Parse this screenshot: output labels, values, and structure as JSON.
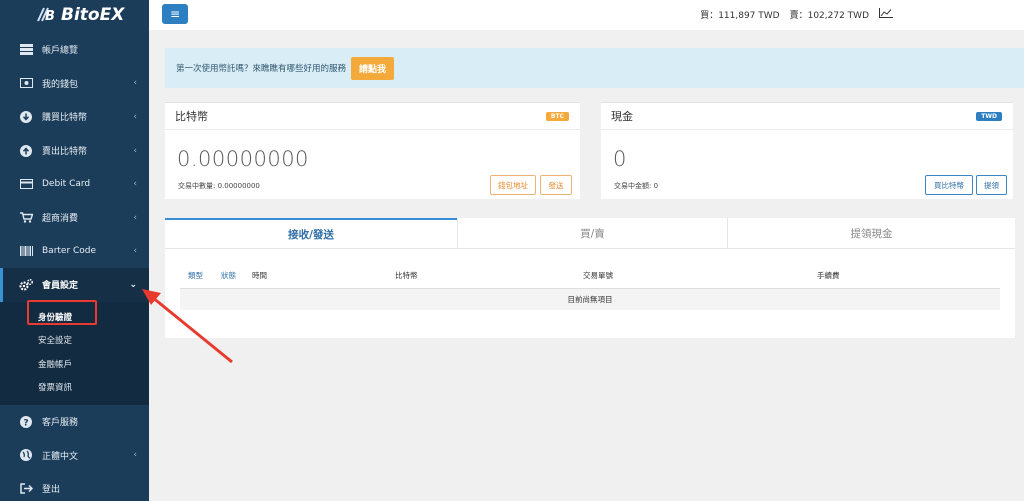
{
  "brand": {
    "name": "BitoEX"
  },
  "sidebar": {
    "items": [
      {
        "label": "帳戶總覽",
        "icon": "dashboard-icon",
        "chevron": false
      },
      {
        "label": "我的錢包",
        "icon": "wallet-icon",
        "chevron": true
      },
      {
        "label": "購買比特幣",
        "icon": "download-circle-icon",
        "chevron": true
      },
      {
        "label": "賣出比特幣",
        "icon": "upload-circle-icon",
        "chevron": true
      },
      {
        "label": "Debit Card",
        "icon": "credit-card-icon",
        "chevron": true
      },
      {
        "label": "超商消費",
        "icon": "cart-icon",
        "chevron": true
      },
      {
        "label": "Barter Code",
        "icon": "barcode-icon",
        "chevron": true
      },
      {
        "label": "會員設定",
        "icon": "gears-icon",
        "chevron": true,
        "expanded": true
      }
    ],
    "sub_items": [
      {
        "label": "身份驗證",
        "selected": true
      },
      {
        "label": "安全設定"
      },
      {
        "label": "金融帳戶"
      },
      {
        "label": "發票資訊"
      }
    ],
    "bottom_items": [
      {
        "label": "客戶服務",
        "icon": "question-circle-icon"
      },
      {
        "label": "正體中文",
        "icon": "globe-icon",
        "chevron": true
      },
      {
        "label": "登出",
        "icon": "logout-icon"
      }
    ]
  },
  "topbar": {
    "menu_glyph": "≡",
    "buy_price": "買：111,897 TWD",
    "sell_price": "賣：102,272 TWD"
  },
  "banner": {
    "text": "第一次使用幣託嗎？來瞧瞧有哪些好用的服務",
    "button": "請點我"
  },
  "btc_card": {
    "title": "比特幣",
    "badge": "BTC",
    "badge_color": "#f4a93b",
    "balance": "0.00000000",
    "pending": "交易中數量: 0.00000000",
    "btn_address": "錢包地址",
    "btn_send": "發送"
  },
  "cash_card": {
    "title": "現金",
    "badge": "TWD",
    "badge_color": "#2d7fc1",
    "balance": "0",
    "pending": "交易中金額: 0",
    "btn_buy": "買比特幣",
    "btn_withdraw": "提領"
  },
  "tabs": [
    "接收/發送",
    "買/賣",
    "提領現金"
  ],
  "table": {
    "headers": [
      "類型",
      "狀態",
      "時間",
      "比特幣",
      "交易單號",
      "手續費"
    ],
    "empty": "目前尚無項目"
  }
}
